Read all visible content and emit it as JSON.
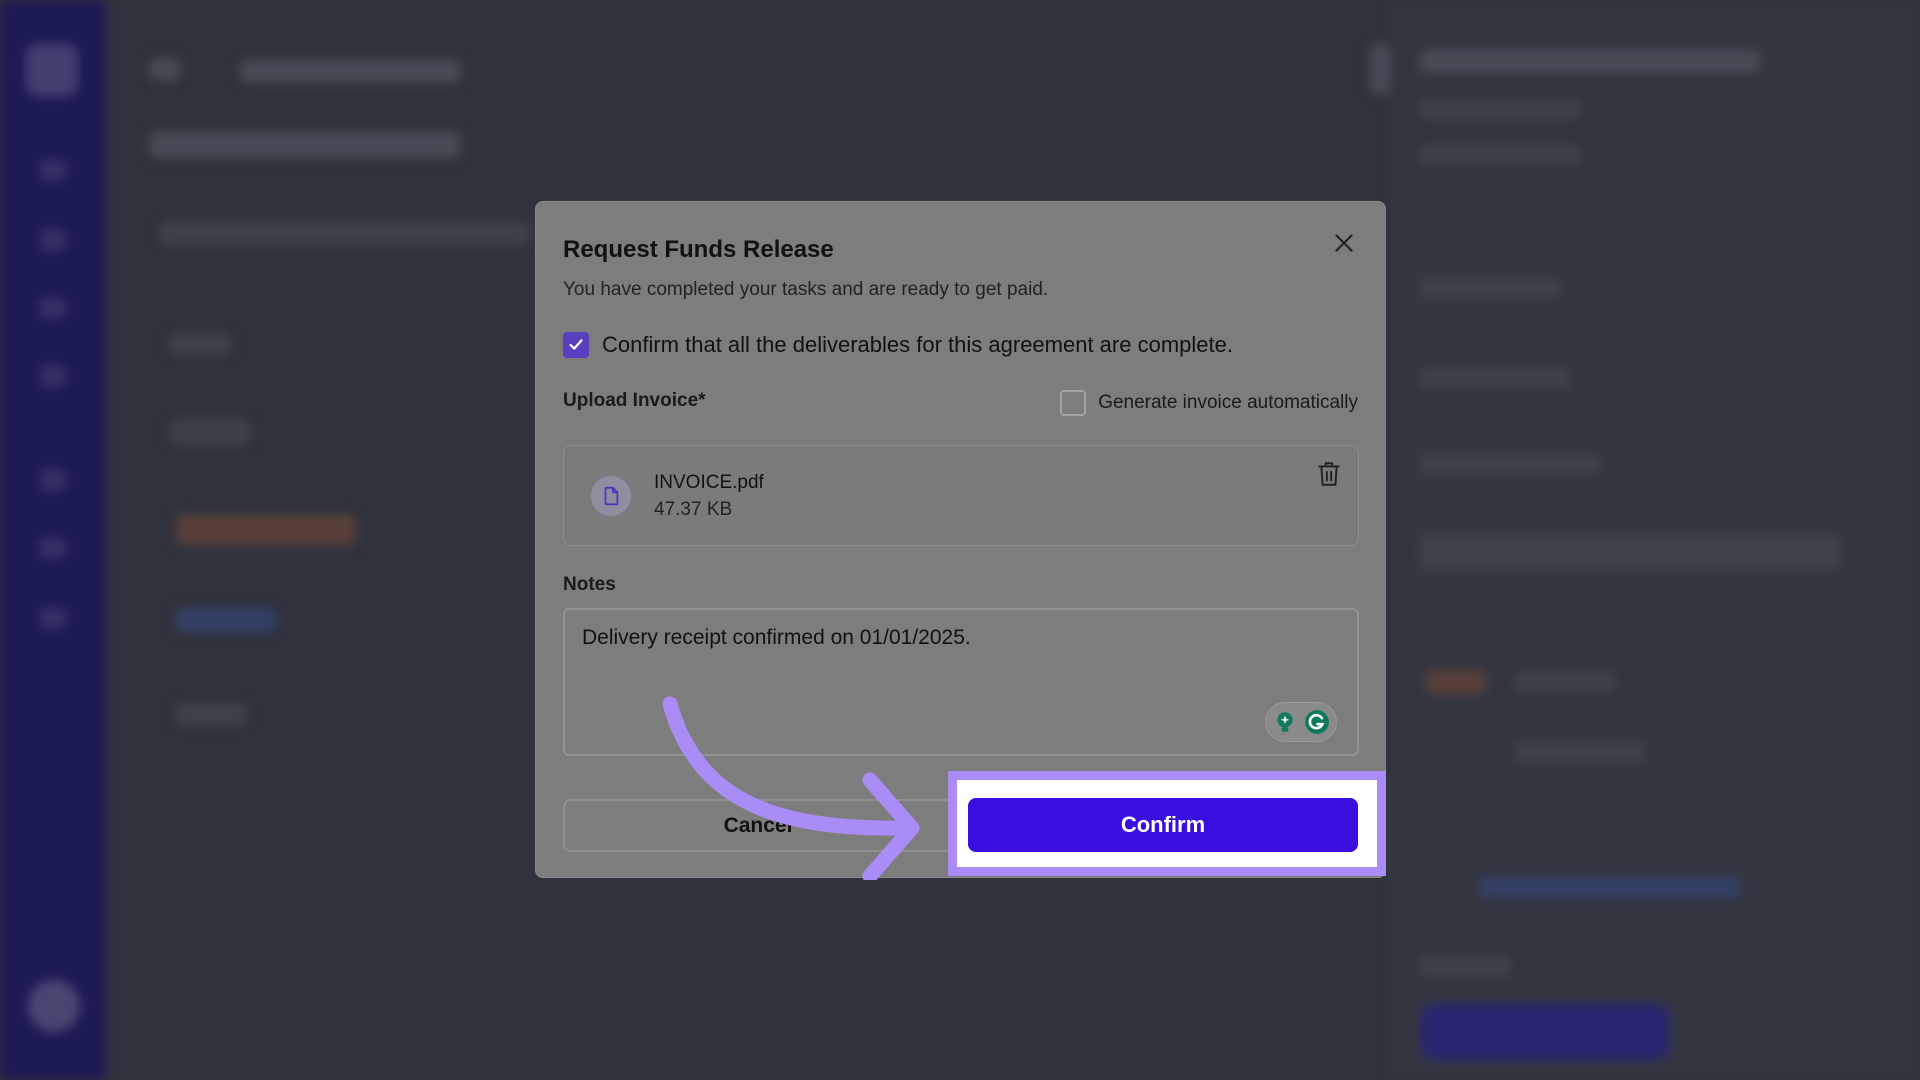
{
  "modal": {
    "title": "Request Funds Release",
    "subtitle": "You have completed your tasks and are ready to get paid.",
    "deliverables_checkbox": {
      "label": "Confirm that all the deliverables for this agreement are complete.",
      "checked": true
    },
    "upload": {
      "label": "Upload Invoice*",
      "generate_auto_label": "Generate invoice automatically",
      "generate_auto_checked": false,
      "file": {
        "name": "INVOICE.pdf",
        "size": "47.37 KB"
      }
    },
    "notes": {
      "label": "Notes",
      "value": "Delivery receipt confirmed on 01/01/2025."
    },
    "buttons": {
      "cancel_label": "Cancel",
      "confirm_label": "Confirm"
    }
  },
  "colors": {
    "primary": "#3b0ee0",
    "highlight": "#a98cf5",
    "sidebar": "#1d1a63",
    "checkbox": "#5a3fbf"
  },
  "icons": {
    "close": "close-icon",
    "file": "file-icon",
    "trash": "trash-icon",
    "check": "check-icon",
    "grammarly": "grammarly-icon"
  }
}
